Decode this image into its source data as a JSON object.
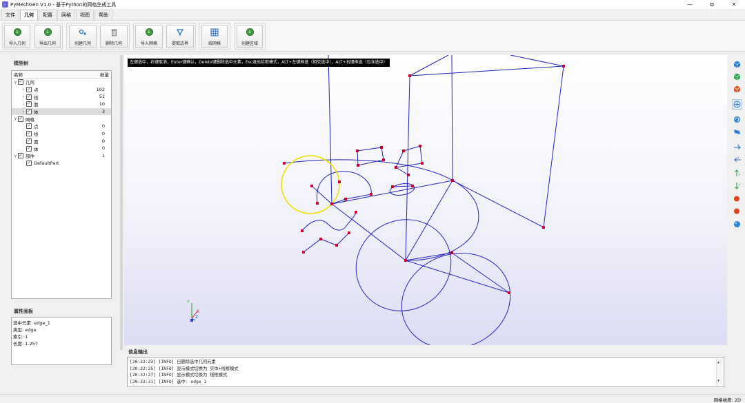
{
  "window": {
    "title": "PyMeshGen V1.0 - 基于Python的网格生成工具",
    "controls": [
      "—",
      "⧉",
      "✕"
    ]
  },
  "menu": {
    "tabs": [
      "文件",
      "几何",
      "配置",
      "网格",
      "视图",
      "帮助"
    ],
    "active": "几何"
  },
  "ribbon": {
    "buttons": {
      "import_geometry": "导入几何",
      "export_geometry": "导出几何",
      "create_geometry": "创建几何",
      "delete_geometry": "删除几何",
      "import_mesh": "导入网格",
      "extract_boundary": "提取边界",
      "line_mesh": "线网格",
      "create_region": "创建区域"
    }
  },
  "model_tree": {
    "title": "模型树",
    "col_name": "名称",
    "col_count": "数量",
    "geometry": {
      "label": "几何",
      "children": [
        {
          "label": "点",
          "count": "102"
        },
        {
          "label": "线",
          "count": "51"
        },
        {
          "label": "面",
          "count": "10"
        },
        {
          "label": "体",
          "count": "3"
        }
      ]
    },
    "mesh": {
      "label": "网格",
      "children": [
        {
          "label": "点",
          "count": "0"
        },
        {
          "label": "线",
          "count": "0"
        },
        {
          "label": "面",
          "count": "0"
        },
        {
          "label": "体",
          "count": "0"
        }
      ]
    },
    "parts": {
      "label": "部件",
      "count": "1",
      "children": [
        {
          "label": "DefaultPart"
        }
      ]
    }
  },
  "properties": {
    "title": "属性面板",
    "lines": [
      "选中元素: edge_1",
      "类型: edge",
      "索引: 1",
      "长度: 1.257"
    ]
  },
  "viewport": {
    "hint": "左键选中，右键取消，Enter键确认，Delete键删除选中元素，Esc退出拾取模式，ALT+左键框选（相交选中），ALT+右键框选（包含选中）",
    "colors": {
      "edges": "#2222bb",
      "vertices": "#cc0033",
      "highlight": "#f0e000"
    },
    "axes": {
      "y": "Y",
      "x": "X",
      "z": "Z"
    }
  },
  "output": {
    "title": "信息输出",
    "lines": [
      "[20:32:23] [INFO] 已删除选中几何元素",
      "[20:32:25] [INFO] 显示模式切换为 实体+线框模式",
      "[20:32:27] [INFO] 显示模式切换为 线框模式",
      "[20:32:31] [INFO] 选中: edge_1"
    ]
  },
  "status": {
    "text": "网格维度: 2D"
  },
  "side_toolbar": {
    "icons": [
      "view-cube-blue-icon",
      "view-cube-green-icon",
      "view-cube-red-icon",
      "fit-view-icon",
      "rotate-view-icon",
      "surface-mode-icon",
      "axis-x-icon",
      "axis-x-neg-icon",
      "axis-y-icon",
      "axis-y-neg-icon",
      "point-red-icon",
      "point-red-2-icon",
      "sphere-blue-icon"
    ]
  }
}
